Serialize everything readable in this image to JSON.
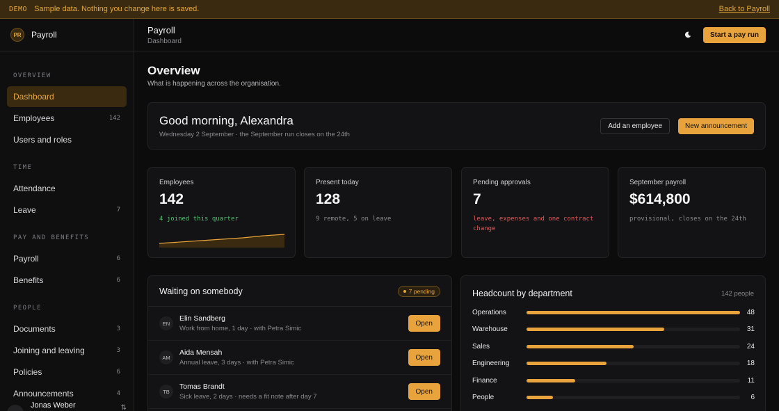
{
  "banner": {
    "tag": "DEMO",
    "message": "Sample data. Nothing you change here is saved.",
    "back_link": "Back to Payroll"
  },
  "brand": {
    "initials": "PR",
    "name": "Payroll"
  },
  "sidebar": {
    "sections": [
      {
        "title": "OVERVIEW",
        "items": [
          {
            "label": "Dashboard",
            "count": "",
            "active": true
          },
          {
            "label": "Employees",
            "count": "142"
          },
          {
            "label": "Users and roles",
            "count": ""
          }
        ]
      },
      {
        "title": "TIME",
        "items": [
          {
            "label": "Attendance",
            "count": ""
          },
          {
            "label": "Leave",
            "count": "7"
          }
        ]
      },
      {
        "title": "PAY AND BENEFITS",
        "items": [
          {
            "label": "Payroll",
            "count": "6"
          },
          {
            "label": "Benefits",
            "count": "6"
          }
        ]
      },
      {
        "title": "PEOPLE",
        "items": [
          {
            "label": "Documents",
            "count": "3"
          },
          {
            "label": "Joining and leaving",
            "count": "3"
          },
          {
            "label": "Policies",
            "count": "6"
          },
          {
            "label": "Announcements",
            "count": "4"
          }
        ]
      }
    ],
    "user": {
      "initials": "JW",
      "name": "Jonas Weber"
    }
  },
  "topbar": {
    "title": "Payroll",
    "subtitle": "Dashboard",
    "theme_icon": "moon-icon",
    "primary_action": "Start a pay run"
  },
  "overview": {
    "title": "Overview",
    "subtitle": "What is happening across the organisation."
  },
  "greeting": {
    "title": "Good morning, Alexandra",
    "subtitle": "Wednesday 2 September · the September run closes on the 24th",
    "add_employee": "Add an employee",
    "new_announcement": "New announcement"
  },
  "stats": [
    {
      "label": "Employees",
      "value": "142",
      "note": "4 joined this quarter",
      "tone": "green"
    },
    {
      "label": "Present today",
      "value": "128",
      "note": "9 remote, 5 on leave",
      "tone": "gray"
    },
    {
      "label": "Pending approvals",
      "value": "7",
      "note": "leave, expenses and one contract change",
      "tone": "red"
    },
    {
      "label": "September payroll",
      "value": "$614,800",
      "note": "provisional, closes on the 24th",
      "tone": "gray"
    }
  ],
  "waiting": {
    "title": "Waiting on somebody",
    "pending_badge": "7 pending",
    "open_label": "Open",
    "rows": [
      {
        "initials": "EN",
        "name": "Elin Sandberg",
        "detail": "Work from home, 1 day · with Petra Simic"
      },
      {
        "initials": "AM",
        "name": "Aida Mensah",
        "detail": "Annual leave, 3 days · with Petra Simic"
      },
      {
        "initials": "TB",
        "name": "Tomas Brandt",
        "detail": "Sick leave, 2 days · needs a fit note after day 7"
      }
    ]
  },
  "headcount": {
    "title": "Headcount by department",
    "total_label": "142 people",
    "max": 48,
    "departments": [
      {
        "name": "Operations",
        "count": 48
      },
      {
        "name": "Warehouse",
        "count": 31
      },
      {
        "name": "Sales",
        "count": 24
      },
      {
        "name": "Engineering",
        "count": 18
      },
      {
        "name": "Finance",
        "count": 11
      },
      {
        "name": "People",
        "count": 6
      }
    ]
  },
  "colors": {
    "accent": "#e8a33c",
    "background": "#0c0c0d",
    "positive": "#4fc06f",
    "negative": "#e0595b"
  }
}
